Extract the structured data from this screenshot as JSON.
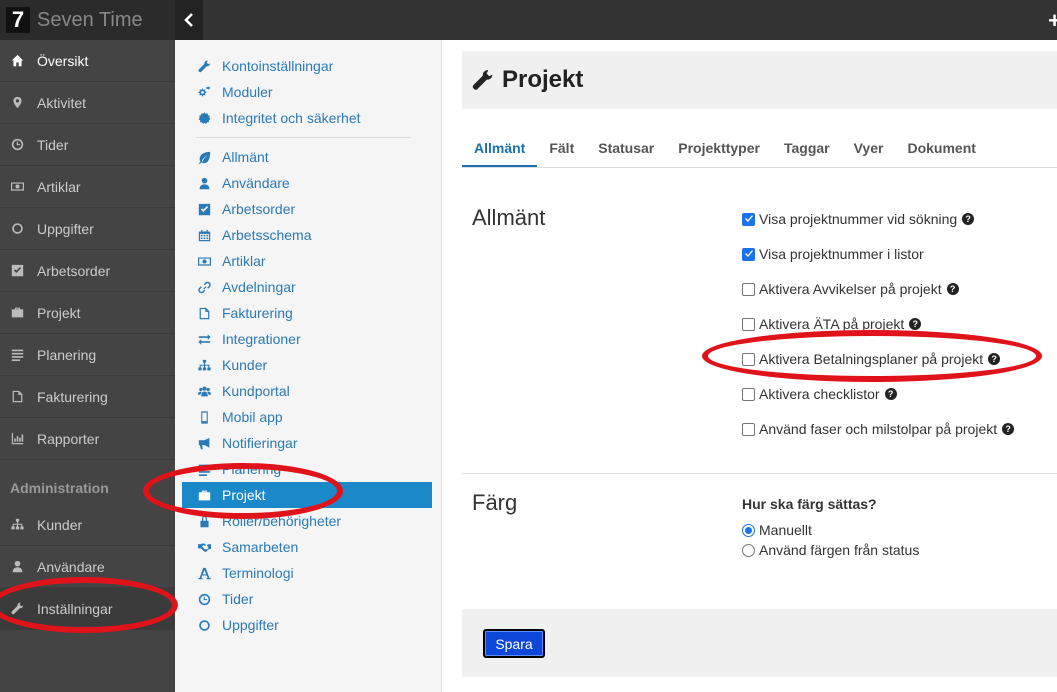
{
  "app": {
    "logo_text": "7",
    "title": "Seven Time",
    "collapse_glyph": "‹",
    "add_glyph": "+"
  },
  "sidebar": {
    "items": [
      {
        "label": "Översikt",
        "icon": "home-icon",
        "active": true
      },
      {
        "label": "Aktivitet",
        "icon": "map-marker-icon"
      },
      {
        "label": "Tider",
        "icon": "clock-icon"
      },
      {
        "label": "Artiklar",
        "icon": "money-icon"
      },
      {
        "label": "Uppgifter",
        "icon": "circle-icon"
      },
      {
        "label": "Arbetsorder",
        "icon": "check-square-icon"
      },
      {
        "label": "Projekt",
        "icon": "briefcase-icon"
      },
      {
        "label": "Planering",
        "icon": "list-icon"
      },
      {
        "label": "Fakturering",
        "icon": "file-icon"
      },
      {
        "label": "Rapporter",
        "icon": "bar-chart-icon"
      }
    ],
    "admin_heading": "Administration",
    "admin_items": [
      {
        "label": "Kunder",
        "icon": "sitemap-icon"
      },
      {
        "label": "Användare",
        "icon": "user-icon"
      },
      {
        "label": "Inställningar",
        "icon": "wrench-icon"
      }
    ]
  },
  "settings_menu": {
    "top_items": [
      {
        "label": "Kontoinställningar",
        "icon": "wrench-icon"
      },
      {
        "label": "Moduler",
        "icon": "cogs-icon"
      },
      {
        "label": "Integritet och säkerhet",
        "icon": "certificate-icon"
      }
    ],
    "items": [
      {
        "label": "Allmänt",
        "icon": "leaf-icon"
      },
      {
        "label": "Användare",
        "icon": "user-icon"
      },
      {
        "label": "Arbetsorder",
        "icon": "check-square-icon"
      },
      {
        "label": "Arbetsschema",
        "icon": "calendar-icon"
      },
      {
        "label": "Artiklar",
        "icon": "money-icon"
      },
      {
        "label": "Avdelningar",
        "icon": "link-icon"
      },
      {
        "label": "Fakturering",
        "icon": "file-icon"
      },
      {
        "label": "Integrationer",
        "icon": "exchange-icon"
      },
      {
        "label": "Kunder",
        "icon": "sitemap-icon"
      },
      {
        "label": "Kundportal",
        "icon": "users-icon"
      },
      {
        "label": "Mobil app",
        "icon": "mobile-icon"
      },
      {
        "label": "Notifieringar",
        "icon": "bullhorn-icon"
      },
      {
        "label": "Planering",
        "icon": "list-icon"
      },
      {
        "label": "Projekt",
        "icon": "briefcase-icon",
        "active": true
      },
      {
        "label": "Roller/behörigheter",
        "icon": "lock-icon"
      },
      {
        "label": "Samarbeten",
        "icon": "handshake-icon"
      },
      {
        "label": "Terminologi",
        "icon": "font-icon"
      },
      {
        "label": "Tider",
        "icon": "clock-icon"
      },
      {
        "label": "Uppgifter",
        "icon": "circle-icon"
      }
    ]
  },
  "page": {
    "title": "Projekt",
    "tabs": [
      "Allmänt",
      "Fält",
      "Statusar",
      "Projekttyper",
      "Taggar",
      "Vyer",
      "Dokument"
    ],
    "active_tab": "Allmänt",
    "general": {
      "heading": "Allmänt",
      "options": [
        {
          "label": "Visa projektnummer vid sökning",
          "checked": true,
          "help": true
        },
        {
          "label": "Visa projektnummer i listor",
          "checked": true,
          "help": false
        },
        {
          "label": "Aktivera Avvikelser på projekt",
          "checked": false,
          "help": true
        },
        {
          "label": "Aktivera ÄTA på projekt",
          "checked": false,
          "help": true
        },
        {
          "label": "Aktivera Betalningsplaner på projekt",
          "checked": false,
          "help": true
        },
        {
          "label": "Aktivera checklistor",
          "checked": false,
          "help": true
        },
        {
          "label": "Använd faser och milstolpar på projekt",
          "checked": false,
          "help": true
        }
      ]
    },
    "color": {
      "heading": "Färg",
      "question": "Hur ska färg sättas?",
      "options": [
        {
          "label": "Manuellt",
          "selected": true
        },
        {
          "label": "Använd färgen från status",
          "selected": false
        }
      ]
    },
    "save_label": "Spara"
  },
  "colors": {
    "accent": "#1a88c9",
    "annotation": "#e0131b",
    "save_button": "#0d47d9"
  }
}
